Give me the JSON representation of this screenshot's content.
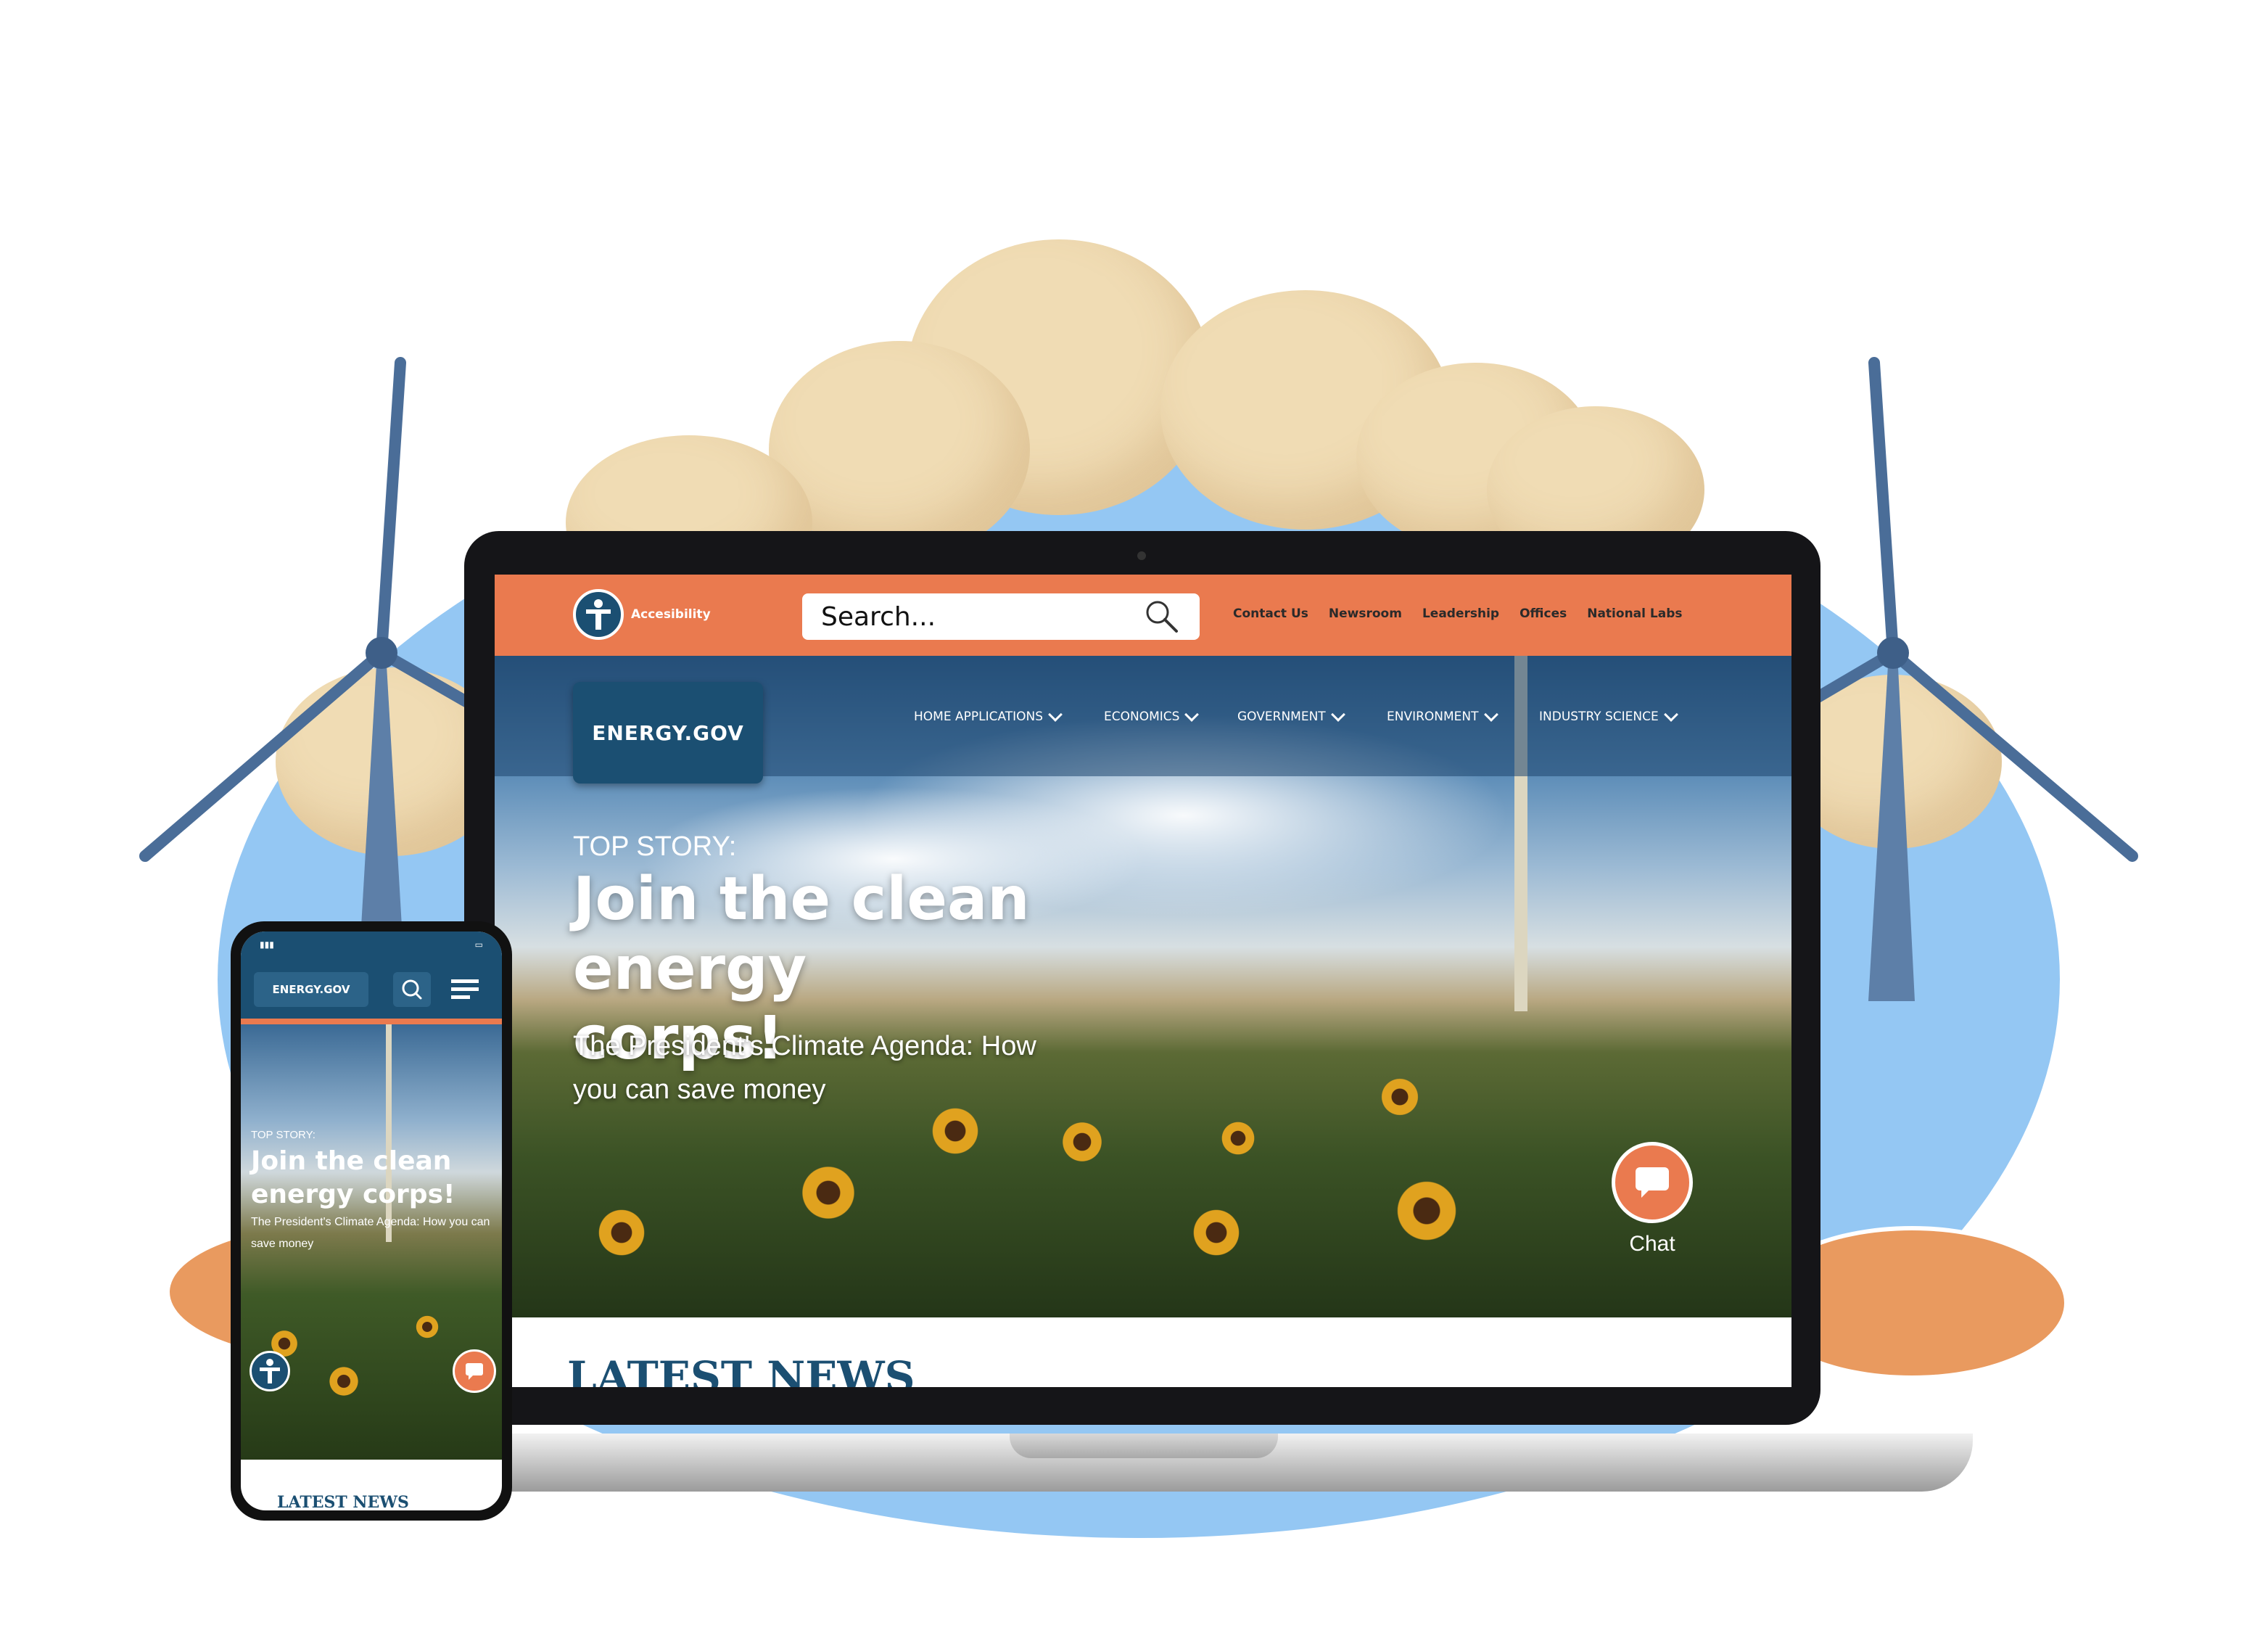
{
  "desktop": {
    "accessibility_label": "Accesibility",
    "search_placeholder": "Search...",
    "top_links": [
      "Contact Us",
      "Newsroom",
      "Leadership",
      "Offices",
      "National Labs"
    ],
    "logo": "ENERGY.GOV",
    "nav": [
      "HOME APPLICATIONS",
      "ECONOMICS",
      "GOVERNMENT",
      "ENVIRONMENT",
      "INDUSTRY SCIENCE"
    ],
    "hero": {
      "kicker": "TOP STORY:",
      "title": "Join the clean energy corps!",
      "subtitle": "The President's Climate Agenda: How you can save money"
    },
    "chat_label": "Chat",
    "latest_news": "LATEST NEWS"
  },
  "mobile": {
    "logo": "ENERGY.GOV",
    "kicker": "TOP STORY:",
    "title": "Join the clean energy corps!",
    "subtitle": "The President's Climate Agenda: How you can save money",
    "latest_news": "LATEST NEWS"
  },
  "colors": {
    "accent": "#ea7a4f",
    "brand": "#1b4f72"
  }
}
